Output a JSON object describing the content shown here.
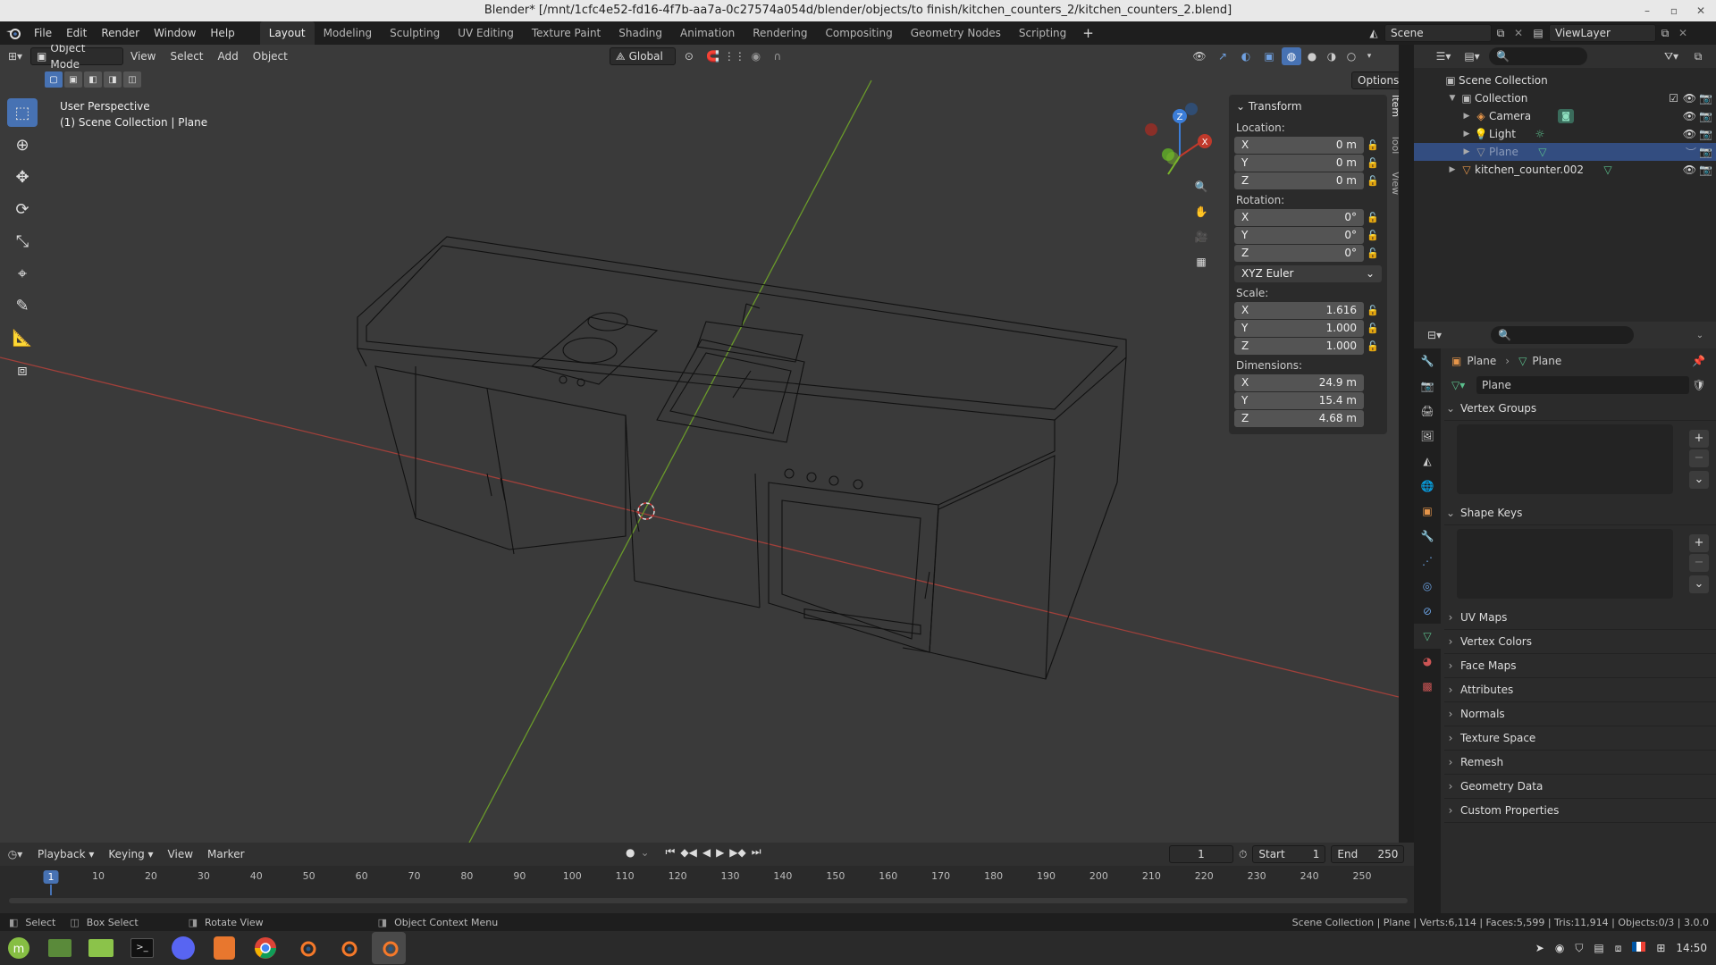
{
  "window": {
    "title": "Blender* [/mnt/1cfc4e52-fd16-4f7b-aa7a-0c27574a054d/blender/objects/to finish/kitchen_counters_2/kitchen_counters_2.blend]"
  },
  "menu": [
    "File",
    "Edit",
    "Render",
    "Window",
    "Help"
  ],
  "workspaces": [
    "Layout",
    "Modeling",
    "Sculpting",
    "UV Editing",
    "Texture Paint",
    "Shading",
    "Animation",
    "Rendering",
    "Compositing",
    "Geometry Nodes",
    "Scripting"
  ],
  "active_workspace": "Layout",
  "scene": {
    "name": "Scene",
    "view_layer": "ViewLayer"
  },
  "viewport": {
    "mode": "Object Mode",
    "menus": [
      "View",
      "Select",
      "Add",
      "Object"
    ],
    "orientation": "Global",
    "options_label": "Options",
    "info_line1": "User Perspective",
    "info_line2": "(1) Scene Collection | Plane",
    "sidebar_tabs": [
      "Item",
      "Tool",
      "View"
    ]
  },
  "transform": {
    "title": "Transform",
    "location_label": "Location:",
    "location": {
      "x": "0 m",
      "y": "0 m",
      "z": "0 m"
    },
    "rotation_label": "Rotation:",
    "rotation": {
      "x": "0°",
      "y": "0°",
      "z": "0°"
    },
    "rotation_mode": "XYZ Euler",
    "scale_label": "Scale:",
    "scale": {
      "x": "1.616",
      "y": "1.000",
      "z": "1.000"
    },
    "dimensions_label": "Dimensions:",
    "dimensions": {
      "x": "24.9 m",
      "y": "15.4 m",
      "z": "4.68 m"
    },
    "axes": {
      "x": "X",
      "y": "Y",
      "z": "Z"
    }
  },
  "outliner": {
    "root": "Scene Collection",
    "items": [
      {
        "name": "Collection"
      },
      {
        "name": "Camera"
      },
      {
        "name": "Light"
      },
      {
        "name": "Plane"
      },
      {
        "name": "kitchen_counter.002"
      }
    ]
  },
  "properties": {
    "breadcrumb_object": "Plane",
    "breadcrumb_data": "Plane",
    "mesh_name": "Plane",
    "panels": {
      "vertex_groups": "Vertex Groups",
      "shape_keys": "Shape Keys",
      "uv_maps": "UV Maps",
      "vertex_colors": "Vertex Colors",
      "face_maps": "Face Maps",
      "attributes": "Attributes",
      "normals": "Normals",
      "texture_space": "Texture Space",
      "remesh": "Remesh",
      "geometry_data": "Geometry Data",
      "custom_properties": "Custom Properties"
    }
  },
  "timeline": {
    "menus": [
      "Playback",
      "Keying",
      "View",
      "Marker"
    ],
    "current_frame": "1",
    "start_label": "Start",
    "start": "1",
    "end_label": "End",
    "end": "250",
    "ruler": [
      "1",
      "10",
      "20",
      "30",
      "40",
      "50",
      "60",
      "70",
      "80",
      "90",
      "100",
      "110",
      "120",
      "130",
      "140",
      "150",
      "160",
      "170",
      "180",
      "190",
      "200",
      "210",
      "220",
      "230",
      "240",
      "250"
    ]
  },
  "status": {
    "select": "Select",
    "box_select": "Box Select",
    "rotate_view": "Rotate View",
    "context_menu": "Object Context Menu",
    "stats": "Scene Collection | Plane | Verts:6,114 | Faces:5,599 | Tris:11,914 | Objects:0/3 | 3.0.0"
  },
  "taskbar": {
    "clock": "14:50"
  },
  "colors": {
    "accent": "#4772b3",
    "x_axis": "#c0392b",
    "y_axis": "#7ab52b",
    "z_axis": "#3b7dd8"
  }
}
